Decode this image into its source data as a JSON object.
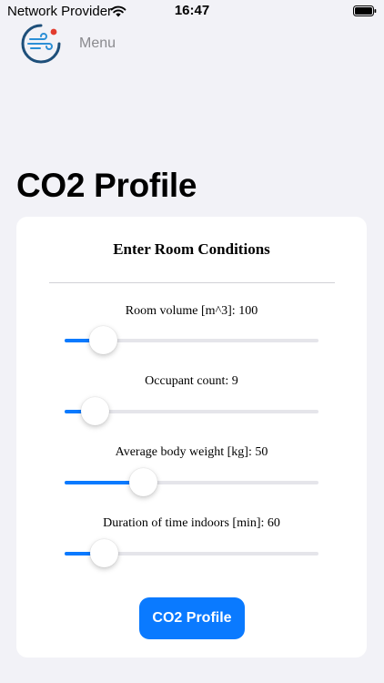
{
  "status_bar": {
    "carrier": "Network Provider",
    "time": "16:47"
  },
  "header": {
    "menu_label": "Menu",
    "logo_icon": "wind-logo-icon"
  },
  "page": {
    "title": "CO2 Profile"
  },
  "form": {
    "title": "Enter Room Conditions",
    "sliders": [
      {
        "label": "Room volume [m^3]: 100",
        "level": 0.15
      },
      {
        "label": "Occupant count: 9",
        "level": 0.12
      },
      {
        "label": "Average body weight [kg]: 50",
        "level": 0.31
      },
      {
        "label": "Duration of time indoors [min]: 60",
        "level": 0.155
      }
    ],
    "submit_label": "CO2 Profile"
  },
  "colors": {
    "accent": "#0a7aff",
    "background": "#f2f2f7",
    "card": "#ffffff"
  }
}
